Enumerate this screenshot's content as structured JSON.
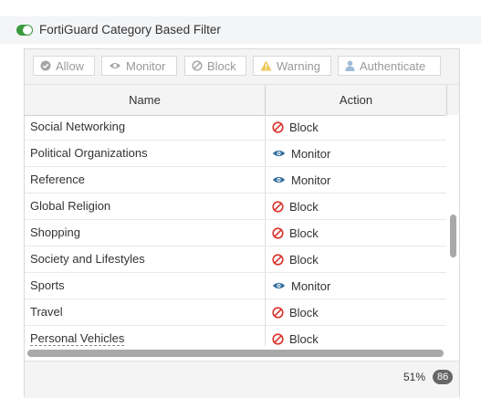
{
  "section": {
    "title": "FortiGuard Category Based Filter",
    "enabled": true
  },
  "toolbar": {
    "buttons": [
      {
        "label": "Allow",
        "icon": "check-circle-icon"
      },
      {
        "label": "Monitor",
        "icon": "eye-icon"
      },
      {
        "label": "Block",
        "icon": "block-icon"
      },
      {
        "label": "Warning",
        "icon": "warning-icon"
      },
      {
        "label": "Authenticate",
        "icon": "user-icon"
      }
    ]
  },
  "table": {
    "columns": [
      "Name",
      "Action"
    ],
    "rows": [
      {
        "name": "Social Networking",
        "action": "Block"
      },
      {
        "name": "Political Organizations",
        "action": "Monitor"
      },
      {
        "name": "Reference",
        "action": "Monitor"
      },
      {
        "name": "Global Religion",
        "action": "Block"
      },
      {
        "name": "Shopping",
        "action": "Block"
      },
      {
        "name": "Society and Lifestyles",
        "action": "Block"
      },
      {
        "name": "Sports",
        "action": "Monitor"
      },
      {
        "name": "Travel",
        "action": "Block"
      },
      {
        "name": "Personal Vehicles",
        "action": "Block"
      }
    ]
  },
  "footer": {
    "percent": "51%",
    "count": "86"
  },
  "scroll": {
    "vertical_position": 0.51
  },
  "colors": {
    "block": "#d9342b",
    "monitor": "#2f6d9c",
    "toggle_on": "#3a9a3e"
  }
}
